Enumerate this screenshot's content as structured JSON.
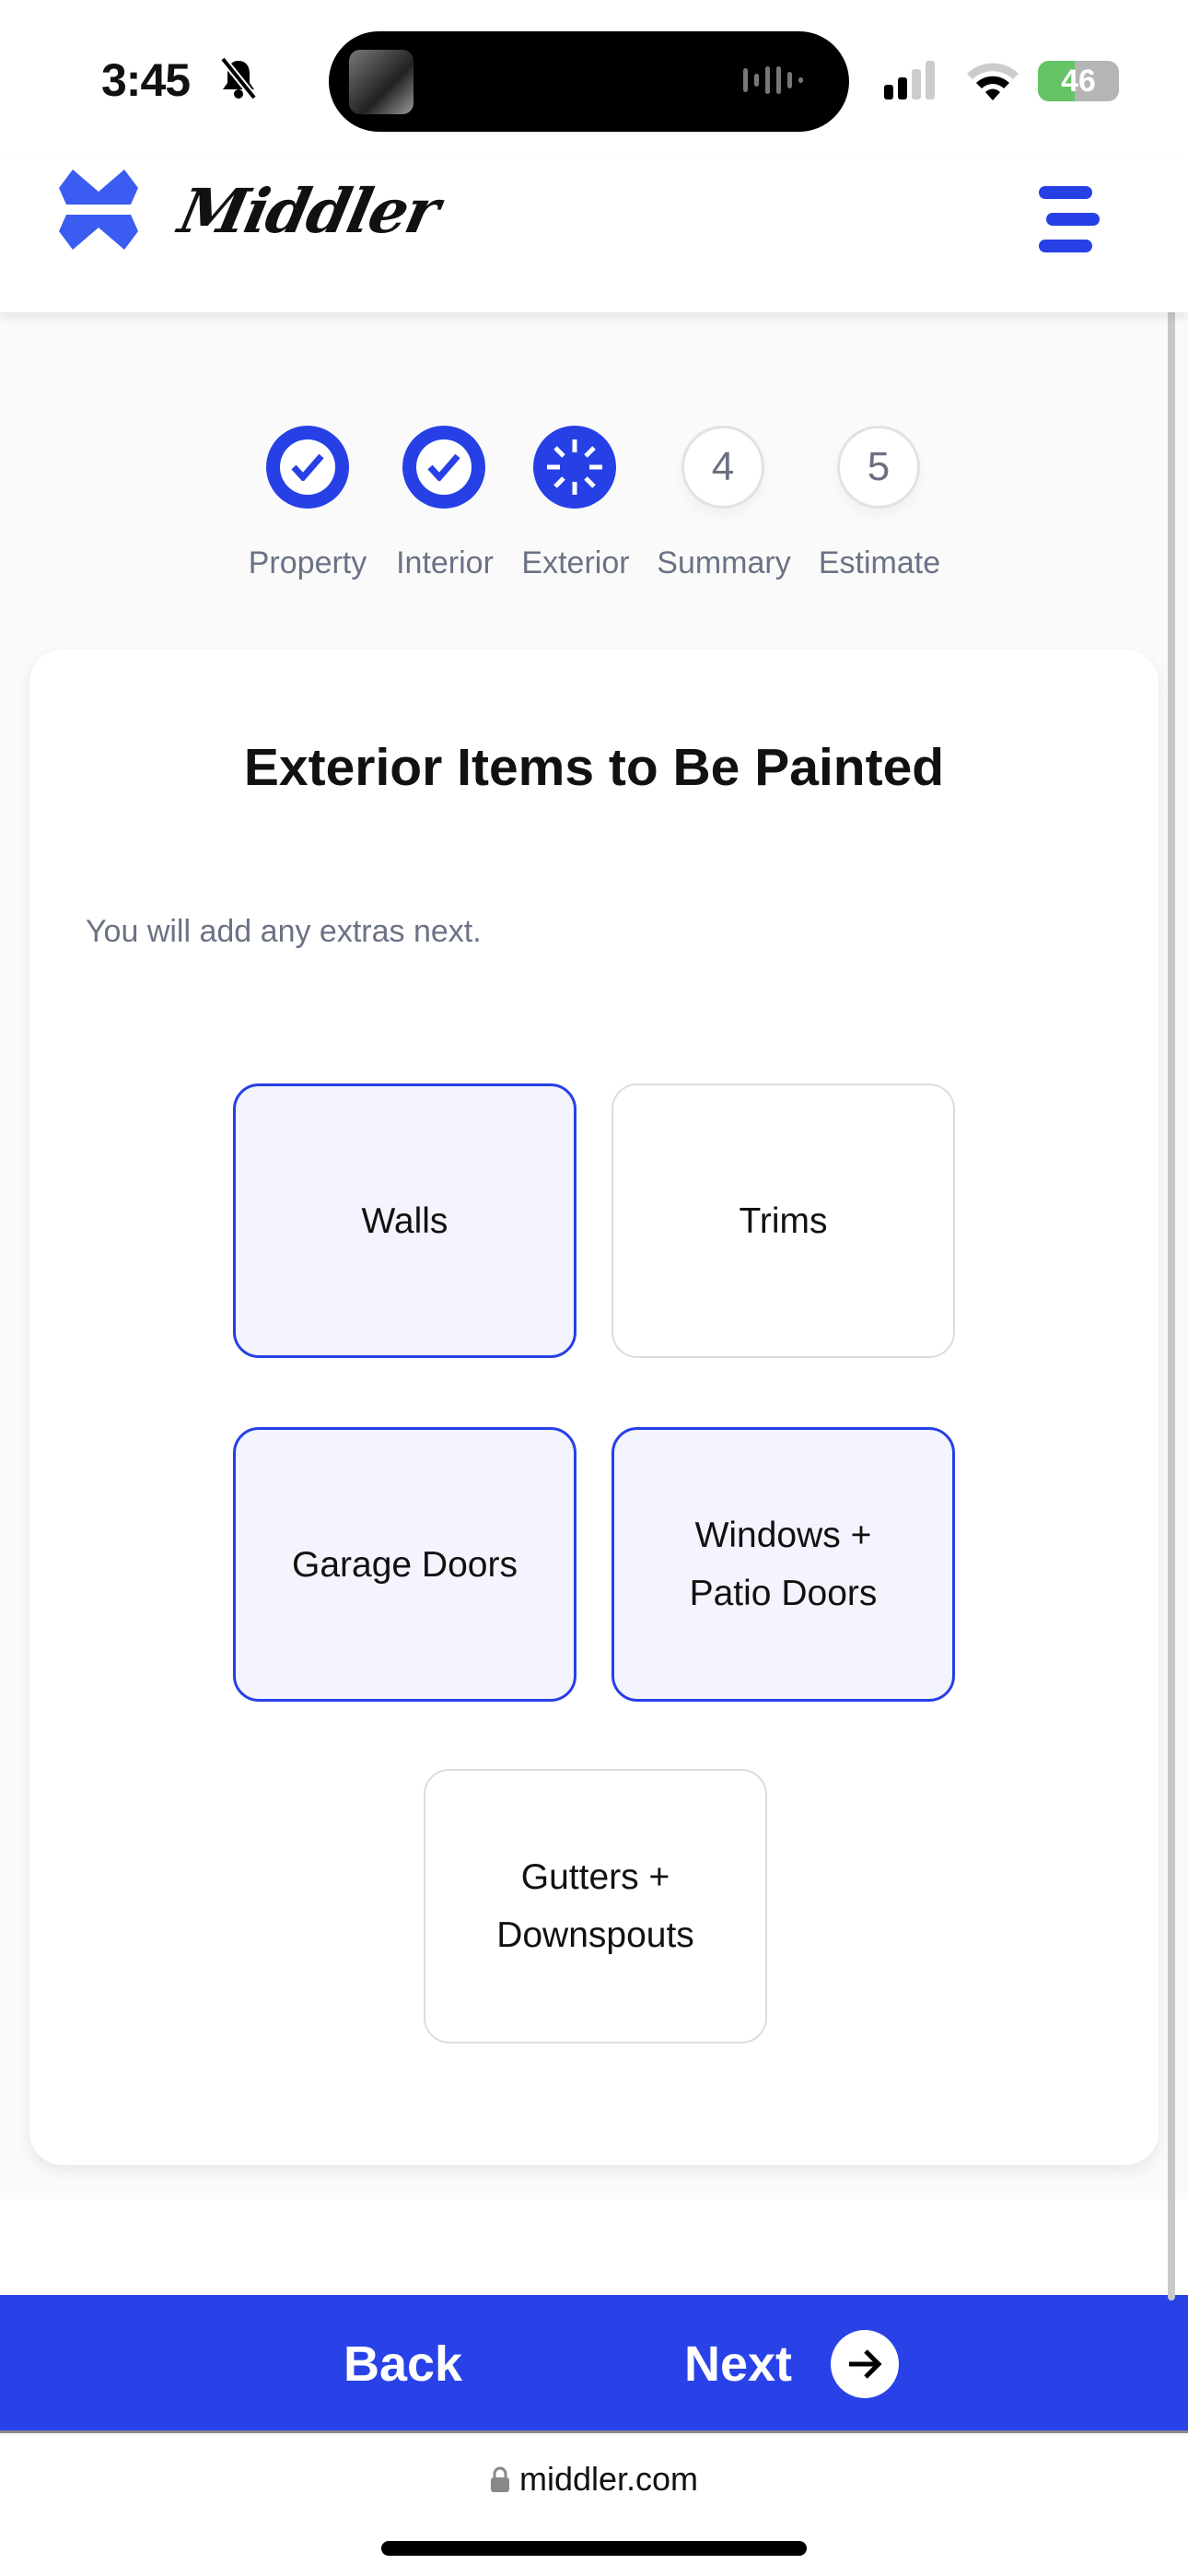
{
  "status_bar": {
    "time": "3:45",
    "battery": "46",
    "icons": [
      "bell-slash-icon",
      "signal-icon",
      "wifi-icon",
      "battery-charging-icon"
    ]
  },
  "header": {
    "brand": "Middler",
    "logo_icon": "middler-logo-icon",
    "menu_icon": "hamburger-menu-icon",
    "accent": "#2740e6"
  },
  "stepper": {
    "steps": [
      {
        "label": "Property",
        "state": "done"
      },
      {
        "label": "Interior",
        "state": "done"
      },
      {
        "label": "Exterior",
        "state": "current"
      },
      {
        "label": "Summary",
        "state": "pending",
        "number": "4"
      },
      {
        "label": "Estimate",
        "state": "pending",
        "number": "5"
      }
    ]
  },
  "main": {
    "title": "Exterior Items to Be Painted",
    "subtitle": "You will add any extras next.",
    "options": [
      {
        "label": "Walls",
        "selected": true
      },
      {
        "label": "Trims",
        "selected": false
      },
      {
        "label": "Garage Doors",
        "selected": true
      },
      {
        "label": "Windows + Patio Doors",
        "selected": true
      },
      {
        "label": "Gutters + Downspouts",
        "selected": false
      }
    ]
  },
  "footer": {
    "back_label": "Back",
    "next_label": "Next",
    "bar_color": "#2942e8"
  },
  "browser": {
    "url": "middler.com"
  }
}
